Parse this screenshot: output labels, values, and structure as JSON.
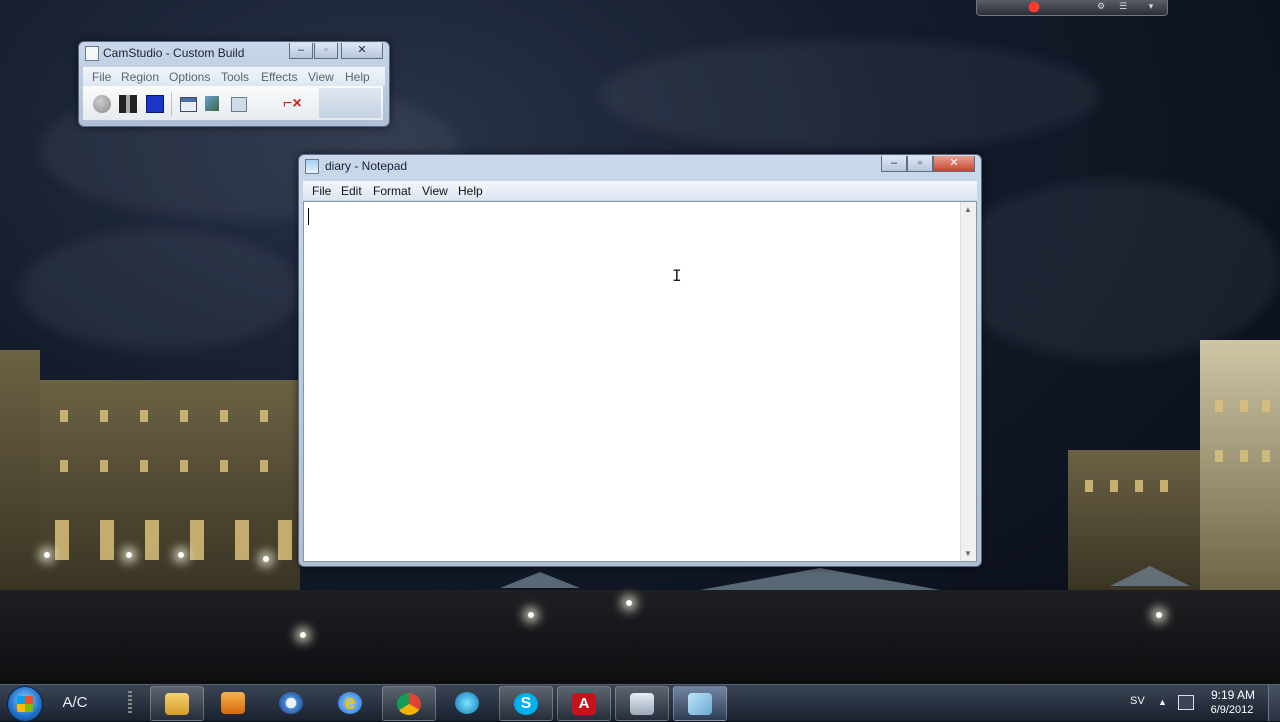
{
  "camstudio": {
    "title": "CamStudio - Custom Build",
    "menu": [
      "File",
      "Region",
      "Options",
      "Tools",
      "Effects",
      "View",
      "Help"
    ]
  },
  "notepad": {
    "title": "diary - Notepad",
    "menu": [
      "File",
      "Edit",
      "Format",
      "View",
      "Help"
    ],
    "content": ""
  },
  "window_controls": {
    "minimize": "–",
    "maximize": "▫",
    "close": "✕"
  },
  "taskbar": {
    "ac_label": "A/C",
    "apps": [
      "file-explorer",
      "media-player",
      "speech-app",
      "internet-explorer",
      "chrome",
      "media-center",
      "skype",
      "adobe",
      "video-app",
      "notepad"
    ],
    "tray": {
      "language": "SV",
      "show_hidden": "▲"
    },
    "clock": {
      "time": "9:19 AM",
      "date": "6/9/2012"
    }
  }
}
